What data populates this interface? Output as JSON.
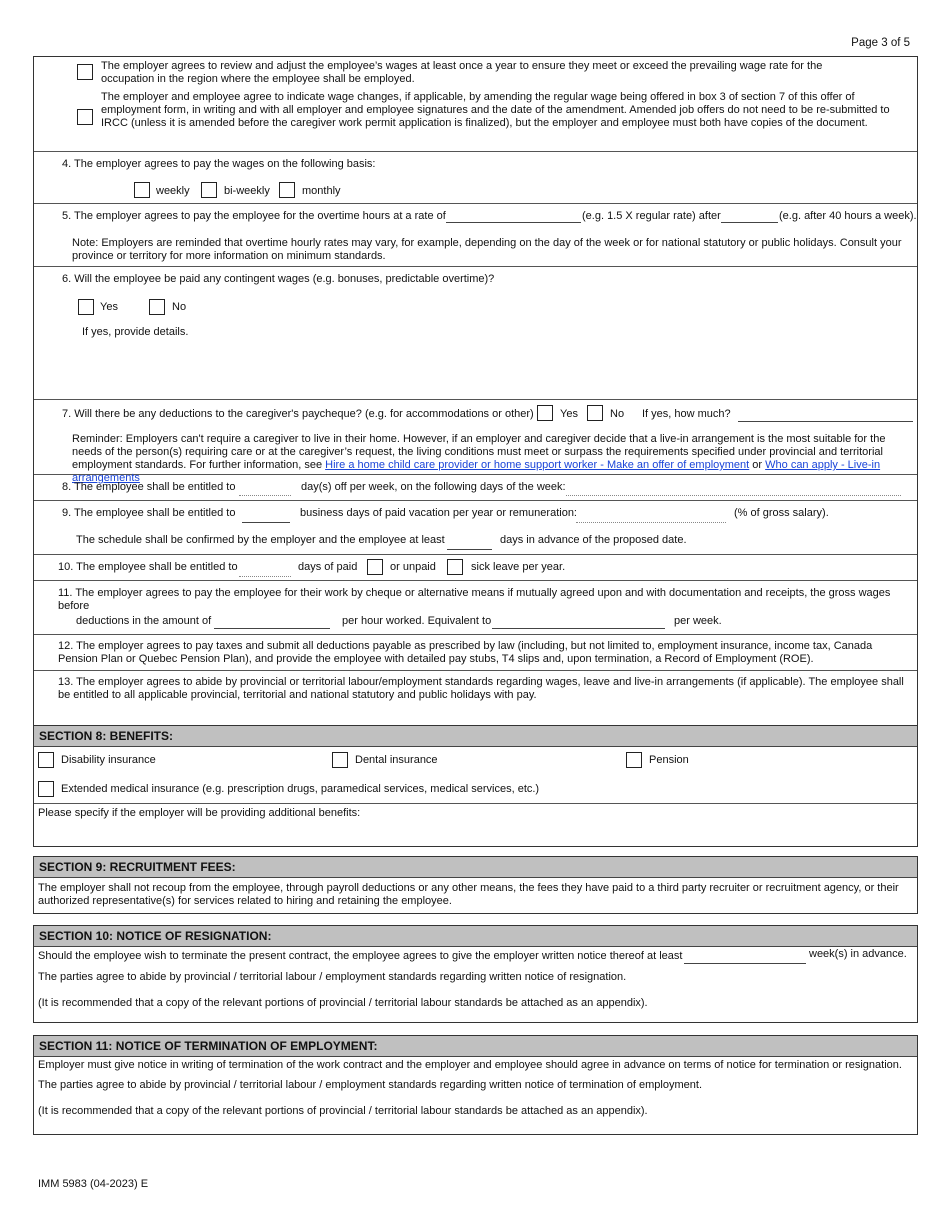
{
  "page": {
    "number": "Page 3 of 5",
    "footer": "IMM 5983 (04-2023) E"
  },
  "wage_review": {
    "review_text": "The employer agrees to review and adjust the employee’s wages at least once a year to ensure they meet or exceed the prevailing wage rate for the occupation in the region where the employee shall be employed.",
    "amend_text": "The employer and employee agree to indicate wage changes, if applicable, by amending the regular wage being offered in box 3 of section 7 of this offer of employment form, in writing and with all employer and employee signatures and the date of the amendment. Amended job offers do not need to be re-submitted to IRCC (unless it is amended before the caregiver work permit application is finalized), but the employer and employee must both have copies of the document."
  },
  "q4": {
    "label": "4. The employer agrees to pay the wages on the following basis:",
    "options": [
      "weekly",
      "bi-weekly",
      "monthly"
    ]
  },
  "q5": {
    "label": "5. The employer agrees to pay the employee for the overtime hours at a rate of",
    "rate_hint": "(e.g. 1.5 X regular rate) after",
    "after_hint": "(e.g. after 40 hours a week).",
    "rate_value": "",
    "after_value": "",
    "note": "Note: Employers are reminded that overtime hourly rates may vary, for example, depending on the day of the week or for national statutory or public holidays. Consult your province or territory for more information on minimum standards."
  },
  "q6": {
    "label": "6. Will the employee be paid any contingent wages (e.g. bonuses, predictable overtime)?",
    "yes": "Yes",
    "no": "No",
    "details_label": "If yes, provide details.",
    "details_value": ""
  },
  "q7": {
    "label": "7. Will there be any deductions to the caregiver's paycheque? (e.g. for accommodations or other)",
    "yes": "Yes",
    "no": "No",
    "how_much_label": "If yes, how much?",
    "how_much_value": "",
    "reminder": "Reminder: Employers can't require a caregiver to live in their home. However, if an employer and caregiver decide that a live-in arrangement is the most suitable for the needs of the person(s) requiring care or at the caregiver’s request, the living conditions must meet or surpass the requirements specified under provincial and territorial employment standards. For further information, see ",
    "link1": "Hire a home child care provider or home support worker - Make an offer of employment",
    "or": " or ",
    "link2": "Who can apply - Live-in arrangements"
  },
  "q8": {
    "label": "8. The employee shall be entitled to",
    "mid": "day(s) off per week, on the following days of the week:",
    "days_value": "",
    "which_days_value": ""
  },
  "q9": {
    "label": "9. The employee shall be entitled to",
    "mid": "business days of paid vacation per year or remuneration:",
    "end": "(% of gross salary).",
    "schedule_label": "The schedule shall be confirmed by the employer and the employee at least",
    "schedule_end": "days in advance of the proposed date."
  },
  "q10": {
    "label": "10. The employee shall be entitled to",
    "mid": "days of paid",
    "unpaid": "or unpaid",
    "end": "sick leave per year."
  },
  "q11": {
    "label": "11. The employer agrees to pay the employee for their work by cheque or alternative means if mutually agreed upon and with documentation and receipts, the gross wages before",
    "amount_label": "deductions in the amount of",
    "per_hour": "per hour worked. Equivalent to",
    "per_week": "per week."
  },
  "q12": {
    "text": "12. The employer agrees to pay taxes and submit all deductions payable as prescribed by law (including, but not limited to, employment insurance, income tax, Canada Pension Plan or Quebec Pension Plan), and provide the employee with detailed pay stubs, T4 slips and, upon termination, a Record of Employment (ROE)."
  },
  "q13": {
    "text": "13. The employer agrees to abide by provincial or territorial labour/employment standards regarding wages, leave and live-in arrangements (if applicable). The employee shall be entitled to all applicable provincial, territorial and national statutory and public holidays with pay."
  },
  "section8": {
    "title": "SECTION 8: BENEFITS:",
    "options": [
      "Disability insurance",
      "Dental insurance",
      "Pension"
    ],
    "extended": "Extended medical insurance (e.g. prescription drugs, paramedical services, medical services, etc.)",
    "additional_label": "Please specify if the employer will be providing additional benefits:"
  },
  "section9": {
    "title": "SECTION 9: RECRUITMENT FEES:",
    "text": "The employer shall not recoup from the employee, through payroll deductions or any other means, the fees they have paid to a third party recruiter or recruitment agency, or their authorized representative(s) for services related to hiring and retaining the employee."
  },
  "section10": {
    "title": "SECTION 10: NOTICE OF RESIGNATION:",
    "line1": "Should the employee wish to terminate the present contract, the employee agrees to give the employer written notice thereof at least",
    "line1_end": "week(s) in advance.",
    "line2": "The parties agree to abide by provincial / territorial labour / employment standards regarding written notice of resignation.",
    "line3": "(It is recommended that a copy of the relevant portions of provincial / territorial labour standards be attached as an appendix)."
  },
  "section11": {
    "title": "SECTION 11: NOTICE OF TERMINATION OF EMPLOYMENT:",
    "line1": "Employer must give notice in writing of termination of the work contract and the employer and employee should agree in advance on terms of notice for termination or resignation.",
    "line2": "The parties agree to abide by provincial / territorial labour / employment standards regarding written notice of termination of employment.",
    "line3": "(It is recommended that a copy of the relevant portions of provincial / territorial labour standards be attached as an appendix)."
  }
}
